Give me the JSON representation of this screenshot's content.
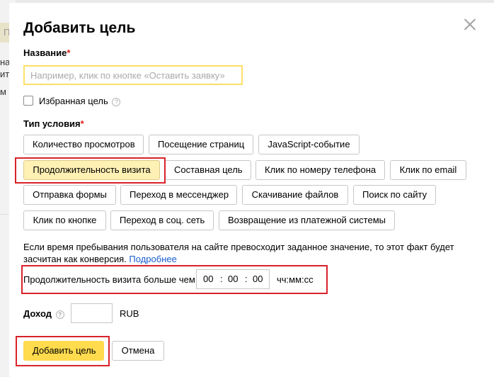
{
  "background": {
    "chip": "П",
    "fragments": [
      "на",
      "ить",
      "м б"
    ]
  },
  "dialog": {
    "title": "Добавить цель",
    "name_label": "Название",
    "required_mark": "*",
    "name_placeholder": "Например, клик по кнопке «Оставить заявку»",
    "favorite_label": "Избранная цель",
    "help_glyph": "?",
    "condition_label": "Тип условия",
    "condition_types": [
      "Количество просмотров",
      "Посещение страниц",
      "JavaScript-событие",
      "Продолжительность визита",
      "Составная цель",
      "Клик по номеру телефона",
      "Клик по email",
      "Отправка формы",
      "Переход в мессенджер",
      "Скачивание файлов",
      "Поиск по сайту",
      "Клик по кнопке",
      "Переход в соц. сеть",
      "Возвращение из платежной системы"
    ],
    "selected_condition": "Продолжительность визита",
    "description": "Если время пребывания пользователя на сайте превосходит заданное значение, то этот факт будет засчитан как конверсия.",
    "more_link": "Подробнее",
    "duration_label": "Продолжительность визита больше чем",
    "time": {
      "hh": "00",
      "mm": "00",
      "ss": "00",
      "sep": ":"
    },
    "time_format": "чч:мм:сс",
    "income_label": "Доход",
    "currency": "RUB",
    "add_button": "Добавить цель",
    "cancel_button": "Отмена"
  },
  "colors": {
    "primary": "#ffdb4d",
    "selected": "#fff0b3",
    "highlight": "#d8222a",
    "link": "#1a5ccc",
    "required": "#e02020"
  },
  "icons": {
    "close": "close-icon",
    "help": "help-icon"
  }
}
